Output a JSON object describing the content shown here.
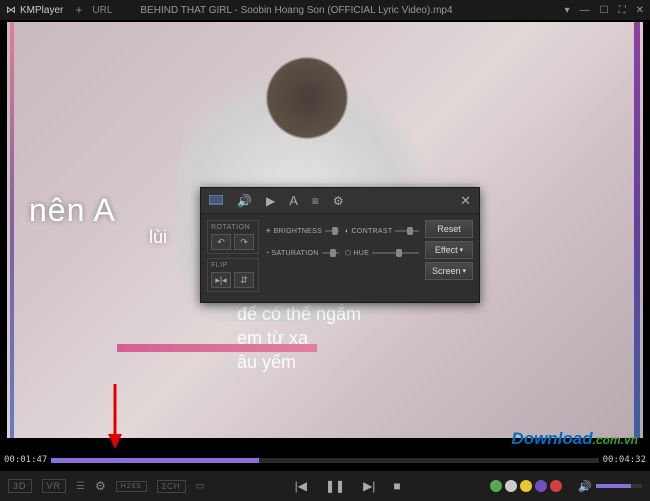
{
  "titlebar": {
    "app_name": "KMPlayer",
    "plus": "+",
    "url_label": "URL",
    "filename": "BEHIND THAT GIRL - Soobin Hoang Son (OFFICIAL Lyric Video).mp4"
  },
  "lyrics": {
    "line1": "nên A",
    "line2": "lùi",
    "center1": "để có thể ngắm",
    "center2": "em từ xa",
    "center3": "âu yếm"
  },
  "panel": {
    "rotation_label": "ROTATION",
    "flip_label": "FLIP",
    "brightness_label": "BRIGHTNESS",
    "contrast_label": "CONTRAST",
    "saturation_label": "SATURATION",
    "hue_label": "HUE",
    "reset_label": "Reset",
    "effect_label": "Effect",
    "screen_label": "Screen"
  },
  "playback": {
    "current_time": "00:01:47",
    "total_time": "00:04:32",
    "progress_percent": 38
  },
  "bottom": {
    "badge_3d": "3D",
    "badge_vr": "VR",
    "badge_h265": "H265",
    "badge_2ch": "2CH",
    "dot_colors": [
      "#58a858",
      "#cccccc",
      "#e8c830",
      "#7050c0",
      "#d04040"
    ]
  },
  "watermark": {
    "main": "Download",
    "suffix": ".com.vn"
  }
}
